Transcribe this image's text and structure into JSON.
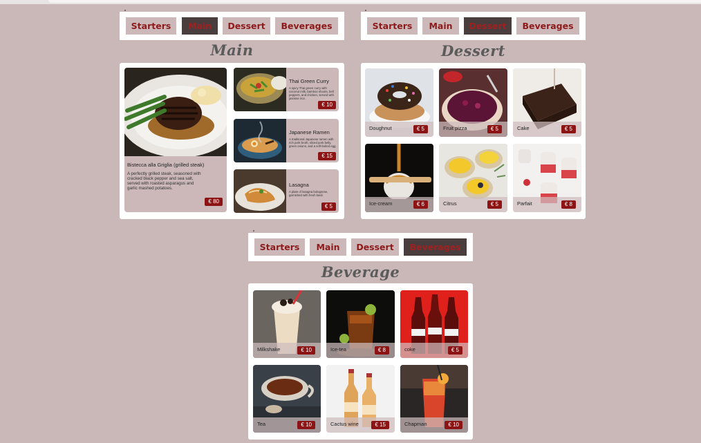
{
  "tabs": [
    "Starters",
    "Main",
    "Dessert",
    "Beverages"
  ],
  "sections": {
    "main": {
      "heading": "Main",
      "featured": {
        "name": "Bistecca alla Griglia (grilled steak)",
        "desc": "A perfectly grilled steak, seasoned with cracked black pepper and sea salt, served with roasted asparagus and garlic mashed potatoes.",
        "price": "€ 80"
      },
      "dishes": [
        {
          "name": "Thai Green Curry",
          "desc": "A spicy Thai green curry with coconut milk, bamboo shoots, bell peppers, and chicken, served with jasmine rice.",
          "price": "€ 10"
        },
        {
          "name": "Japanese Ramen",
          "desc": "A traditional Japanese ramen with rich pork broth, sliced pork belly, green onions, and a soft-boiled egg.",
          "price": "€ 15"
        },
        {
          "name": "Lasagna",
          "desc": "A plate of lasagna bolognese, garnished with fresh basil.",
          "price": "€ 5"
        }
      ]
    },
    "dessert": {
      "heading": "Dessert",
      "items": [
        {
          "name": "Doughnut",
          "price": "€ 5"
        },
        {
          "name": "Fruit pizza",
          "price": "€ 5"
        },
        {
          "name": "Cake",
          "price": "€ 5"
        },
        {
          "name": "Ice-cream",
          "price": "€ 6"
        },
        {
          "name": "Citrus",
          "price": "€ 5"
        },
        {
          "name": "Parfait",
          "price": "€ 8"
        }
      ]
    },
    "beverage": {
      "heading": "Beverage",
      "items": [
        {
          "name": "Milkshake",
          "price": "€ 10"
        },
        {
          "name": "Ice-tea",
          "price": "€ 8"
        },
        {
          "name": "coke",
          "price": "€ 5"
        },
        {
          "name": "Tea",
          "price": "€ 10"
        },
        {
          "name": "Cactus wine",
          "price": "€ 15"
        },
        {
          "name": "Chapman",
          "price": "€ 10"
        }
      ]
    }
  },
  "colors": {
    "background": "#cab7b8",
    "accent": "#8c1414",
    "tab": "#ccb8b9",
    "tab_active": "#4a3d3e"
  }
}
